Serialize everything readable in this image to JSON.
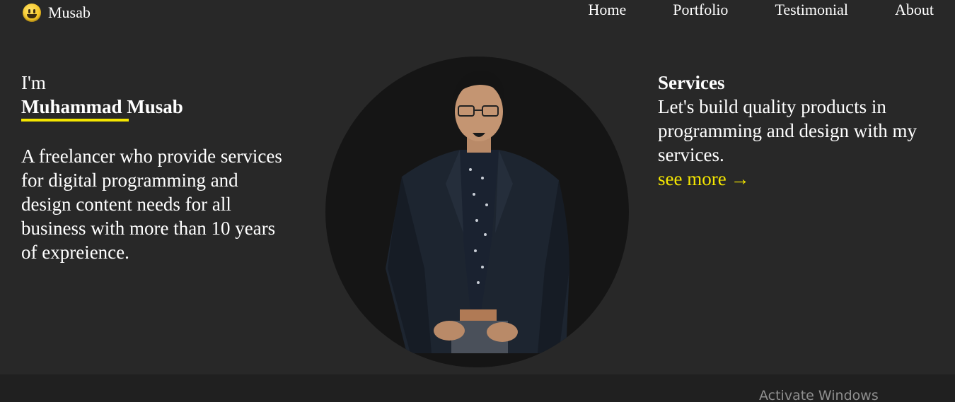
{
  "header": {
    "brand": {
      "icon": "grinning-face-icon",
      "name": "Musab"
    },
    "nav": [
      {
        "label": "Home"
      },
      {
        "label": "Portfolio"
      },
      {
        "label": "Testimonial"
      },
      {
        "label": "About"
      }
    ]
  },
  "intro": {
    "greeting": "I'm",
    "name": "Muhammad Musab",
    "bio": "A freelancer who provide services for digital programming and design content needs for all business with more than 10 years of expreience."
  },
  "portrait": {
    "icon": "profile-photo"
  },
  "services": {
    "title": "Services",
    "text": "Let's build quality products in programming and design with my services.",
    "link_label": "see more",
    "link_arrow": "→"
  },
  "watermark": {
    "text": "Activate Windows"
  },
  "colors": {
    "background": "#282828",
    "footer": "#202020",
    "accent": "#f4e600",
    "text": "#ffffff",
    "portrait_bg": "#151515"
  }
}
